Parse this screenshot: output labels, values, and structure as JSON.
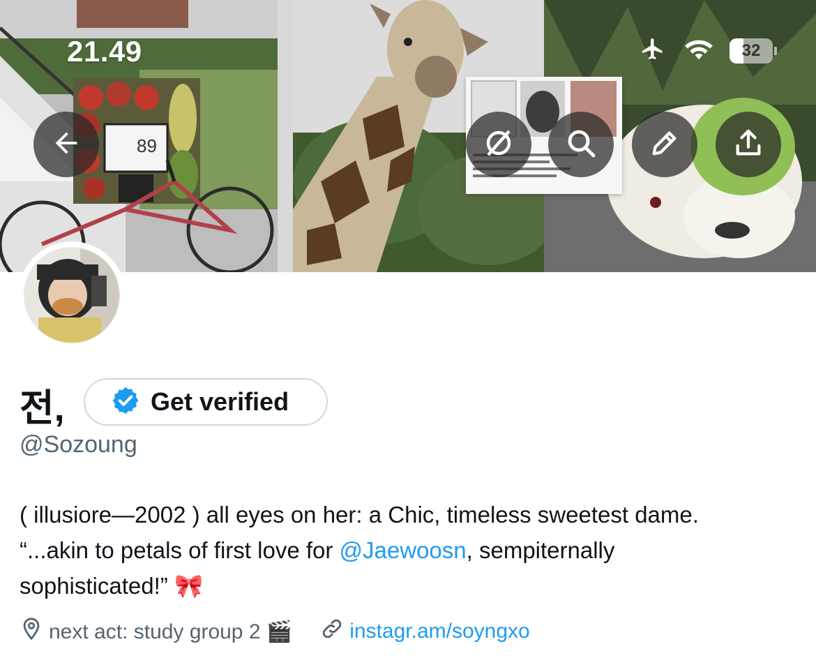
{
  "status_bar": {
    "time": "21.49",
    "battery_level": "32",
    "icons": [
      "airplane-icon",
      "wifi-icon",
      "battery-icon"
    ]
  },
  "header_actions": {
    "back": "arrow-left-icon",
    "actions": [
      "no-filter-icon",
      "search-icon",
      "pencil-icon",
      "share-icon"
    ]
  },
  "banner": {
    "price_tag": "89"
  },
  "profile": {
    "display_name": "전,",
    "verify_label": "Get verified",
    "handle": "@Sozoung",
    "bio_part1": "( illusiore—2002 ) all eyes on her: a Chic, timeless sweetest dame.",
    "bio_part2": "“...akin to petals of first love for ",
    "bio_mention": "@Jaewoosn",
    "bio_part3": ", sempiternally",
    "bio_part4": "sophisticated!” 🎀",
    "location": "next act: study group 2 🎬",
    "website": "instagr.am/soyngxo"
  },
  "colors": {
    "accent": "#1d9bf0",
    "secondary_text": "#536471",
    "border": "#cfd9de"
  }
}
